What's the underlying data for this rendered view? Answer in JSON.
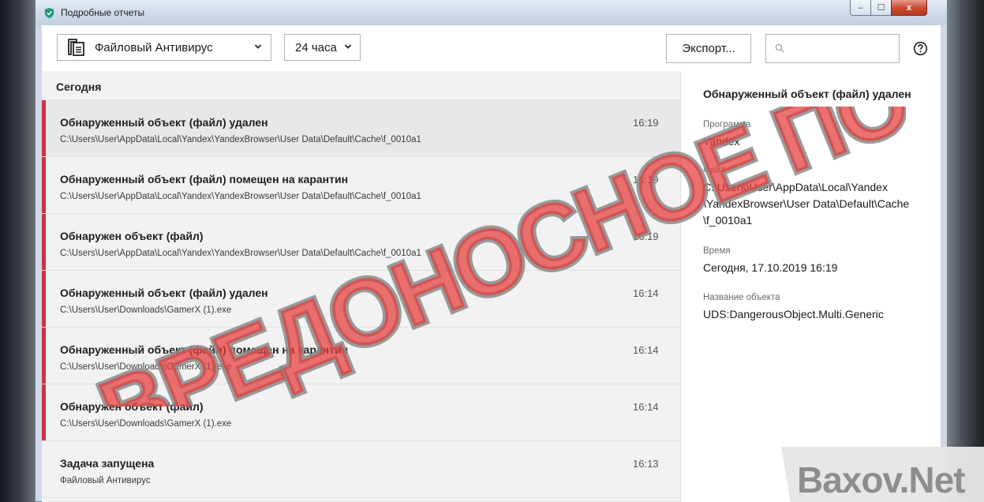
{
  "window": {
    "title": "Подробные отчеты",
    "controls": {
      "minimize": "‒",
      "maximize": "☐",
      "close": "x"
    }
  },
  "toolbar": {
    "component_dropdown": {
      "value": "Файловый Антивирус",
      "icon": "document-pages-icon"
    },
    "period_dropdown": {
      "value": "24 часа"
    },
    "export_label": "Экспорт...",
    "search": {
      "placeholder": "",
      "value": ""
    },
    "help_icon": "question-circle-icon"
  },
  "list": {
    "section_title": "Сегодня",
    "items": [
      {
        "title": "Обнаруженный объект (файл) удален",
        "path": "C:\\Users\\User\\AppData\\Local\\Yandex\\YandexBrowser\\User Data\\Default\\Cache\\f_0010a1",
        "time": "16:19",
        "severity": "critical",
        "selected": true
      },
      {
        "title": "Обнаруженный объект (файл) помещен на карантин",
        "path": "C:\\Users\\User\\AppData\\Local\\Yandex\\YandexBrowser\\User Data\\Default\\Cache\\f_0010a1",
        "time": "16:19",
        "severity": "critical",
        "selected": false
      },
      {
        "title": "Обнаружен объект (файл)",
        "path": "C:\\Users\\User\\AppData\\Local\\Yandex\\YandexBrowser\\User Data\\Default\\Cache\\f_0010a1",
        "time": "16:19",
        "severity": "critical",
        "selected": false
      },
      {
        "title": "Обнаруженный объект (файл) удален",
        "path": "C:\\Users\\User\\Downloads\\GamerX (1).exe",
        "time": "16:14",
        "severity": "critical",
        "selected": false
      },
      {
        "title": "Обнаруженный объект (файл) помещен на карантин",
        "path": "C:\\Users\\User\\Downloads\\GamerX (1).exe",
        "time": "16:14",
        "severity": "critical",
        "selected": false
      },
      {
        "title": "Обнаружен объект (файл)",
        "path": "C:\\Users\\User\\Downloads\\GamerX (1).exe",
        "time": "16:14",
        "severity": "critical",
        "selected": false
      },
      {
        "title": "Задача запущена",
        "path": "Файловый Антивирус",
        "time": "16:13",
        "severity": "info",
        "selected": false
      }
    ]
  },
  "detail": {
    "heading": "Обнаруженный объект (файл) удален",
    "program_label": "Программа",
    "program_value": "Yandex",
    "file_label": "Файл",
    "file_lines": [
      "C:\\Users\\User\\AppData\\Local\\Yandex",
      "\\YandexBrowser\\User Data\\Default\\Cache",
      "\\f_0010a1"
    ],
    "time_label": "Время",
    "time_value": "Сегодня, 17.10.2019 16:19",
    "object_label": "Название объекта",
    "object_value": "UDS:DangerousObject.Multi.Generic"
  },
  "overlay": {
    "stamp_text": "ВРЕДОНОСНОЕ ПО",
    "watermark_text": "Baxov.Net"
  },
  "colors": {
    "critical_bar": "#d0313e",
    "stamp": "#e53a3a",
    "titlebar": "#cfdbea"
  }
}
